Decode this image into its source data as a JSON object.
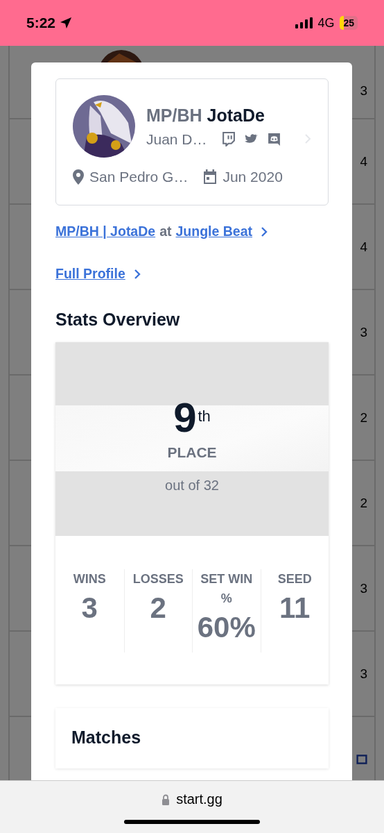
{
  "status_bar": {
    "time": "5:22",
    "network": "4G",
    "battery": "25"
  },
  "background_list": {
    "rows": [
      {
        "kind": "player",
        "column_2": "3"
      },
      {
        "kind": "number",
        "column_2": "4"
      },
      {
        "kind": "number",
        "column_2": "4"
      },
      {
        "kind": "number",
        "column_2": "3"
      },
      {
        "kind": "number",
        "column_2": "2"
      },
      {
        "kind": "number",
        "column_2": "2"
      },
      {
        "kind": "number",
        "column_2": "3"
      },
      {
        "kind": "number",
        "column_2": "3"
      },
      {
        "kind": "icon"
      }
    ]
  },
  "modal": {
    "profile": {
      "prefix": "MP/BH",
      "gamer_tag": "JotaDe",
      "real_name": "Juan D…",
      "location": "San Pedro G…",
      "joined": "Jun 2020"
    },
    "event_link": {
      "player": "MP/BH | JotaDe",
      "connector": "at",
      "event": "Jungle Beat"
    },
    "full_profile_link": "Full Profile",
    "stats_title": "Stats Overview",
    "placement": {
      "rank": "9",
      "suffix": "th",
      "label": "PLACE",
      "total": "out of 32"
    },
    "stats": [
      {
        "label": "WINS",
        "value": "3"
      },
      {
        "label": "LOSSES",
        "value": "2"
      },
      {
        "label": "SET WIN %",
        "value": "60%"
      },
      {
        "label": "SEED",
        "value": "11"
      }
    ],
    "matches_title": "Matches"
  },
  "address_bar": {
    "url": "start.gg"
  }
}
